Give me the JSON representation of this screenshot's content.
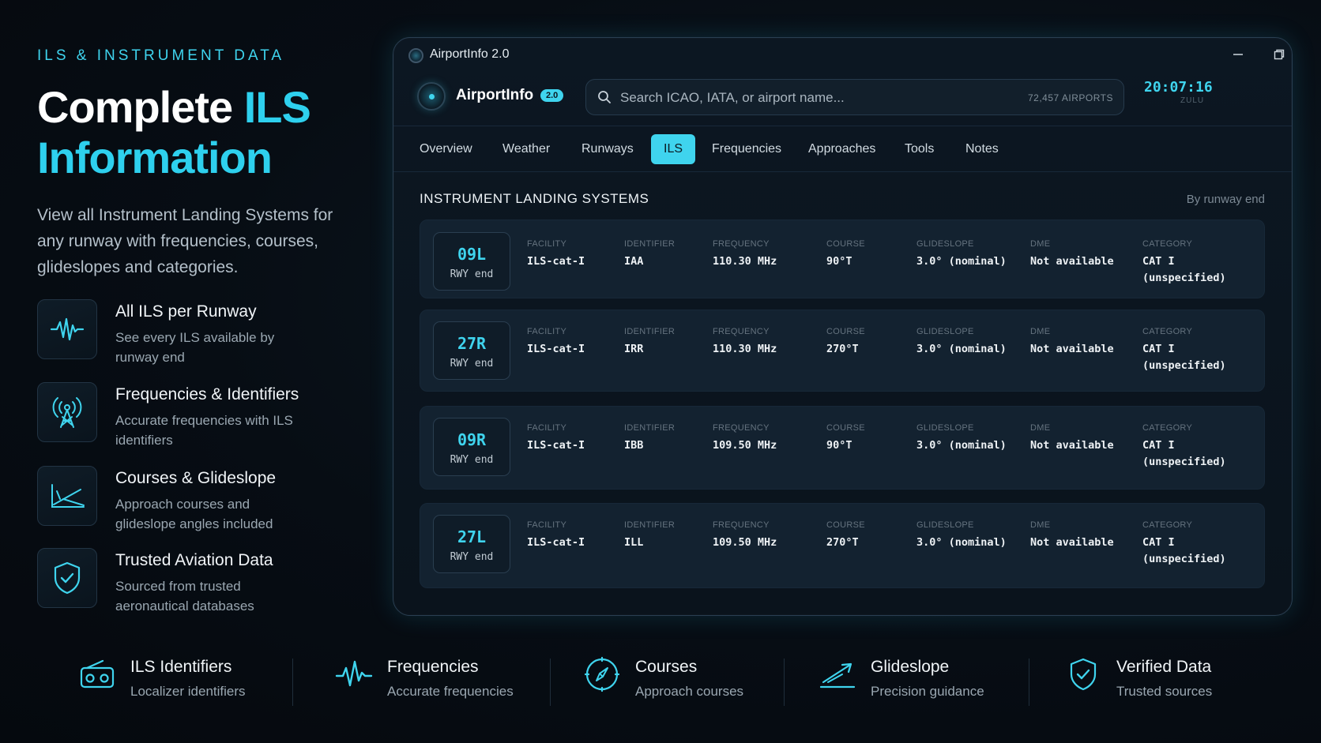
{
  "promo": {
    "eyebrow": "ILS & INSTRUMENT DATA",
    "headline_white": "Complete ",
    "headline_cyan_1": "ILS",
    "headline_cyan_2": "Information",
    "lead": "View all Instrument Landing Systems for any runway with frequencies, courses, glideslopes and categories.",
    "features": [
      {
        "icon": "waveform-icon",
        "title": "All ILS per Runway",
        "desc": "See every ILS available by runway end"
      },
      {
        "icon": "antenna-icon",
        "title": "Frequencies & Identifiers",
        "desc": "Accurate frequencies with ILS identifiers"
      },
      {
        "icon": "glideslope-chart-icon",
        "title": "Courses & Glideslope",
        "desc": "Approach courses and glideslope angles included"
      },
      {
        "icon": "shield-check-icon",
        "title": "Trusted Aviation Data",
        "desc": "Sourced from trusted aeronautical databases"
      }
    ]
  },
  "window": {
    "title": "AirportInfo 2.0",
    "brand": "AirportInfo",
    "version": "2.0",
    "search": {
      "placeholder": "Search ICAO, IATA, or airport name...",
      "value": "",
      "count": "72,457 AIRPORTS"
    },
    "clock": {
      "time": "20:07:16",
      "zone": "ZULU"
    },
    "tabs": [
      "Overview",
      "Weather",
      "Runways",
      "ILS",
      "Frequencies",
      "Approaches",
      "Tools",
      "Notes"
    ],
    "active_tab": "ILS",
    "section_title": "INSTRUMENT LANDING SYSTEMS",
    "section_note": "By runway end",
    "column_labels": {
      "facility": "FACILITY",
      "identifier": "IDENTIFIER",
      "frequency": "FREQUENCY",
      "course": "COURSE",
      "glideslope": "GLIDESLOPE",
      "dme": "DME",
      "category": "CATEGORY"
    },
    "rwy_suffix": "RWY end",
    "ils_rows": [
      {
        "runway": "09L",
        "facility": "ILS-cat-I",
        "identifier": "IAA",
        "frequency": "110.30 MHz",
        "course": "90°T",
        "glideslope": "3.0° (nominal)",
        "dme": "Not available",
        "category_1": "CAT I",
        "category_2": "(unspecified)"
      },
      {
        "runway": "27R",
        "facility": "ILS-cat-I",
        "identifier": "IRR",
        "frequency": "110.30 MHz",
        "course": "270°T",
        "glideslope": "3.0° (nominal)",
        "dme": "Not available",
        "category_1": "CAT I",
        "category_2": "(unspecified)"
      },
      {
        "runway": "09R",
        "facility": "ILS-cat-I",
        "identifier": "IBB",
        "frequency": "109.50 MHz",
        "course": "90°T",
        "glideslope": "3.0° (nominal)",
        "dme": "Not available",
        "category_1": "CAT I",
        "category_2": "(unspecified)"
      },
      {
        "runway": "27L",
        "facility": "ILS-cat-I",
        "identifier": "ILL",
        "frequency": "109.50 MHz",
        "course": "270°T",
        "glideslope": "3.0° (nominal)",
        "dme": "Not available",
        "category_1": "CAT I",
        "category_2": "(unspecified)"
      }
    ]
  },
  "bottom": [
    {
      "icon": "radio-icon",
      "title": "ILS Identifiers",
      "desc": "Localizer identifiers"
    },
    {
      "icon": "pulse-icon",
      "title": "Frequencies",
      "desc": "Accurate frequencies"
    },
    {
      "icon": "compass-icon",
      "title": "Courses",
      "desc": "Approach courses"
    },
    {
      "icon": "descent-icon",
      "title": "Glideslope",
      "desc": "Precision guidance"
    },
    {
      "icon": "shield-check-icon",
      "title": "Verified Data",
      "desc": "Trusted sources"
    }
  ],
  "colors": {
    "accent": "#3fd4ee",
    "background": "#070d14",
    "panel": "#132230"
  }
}
